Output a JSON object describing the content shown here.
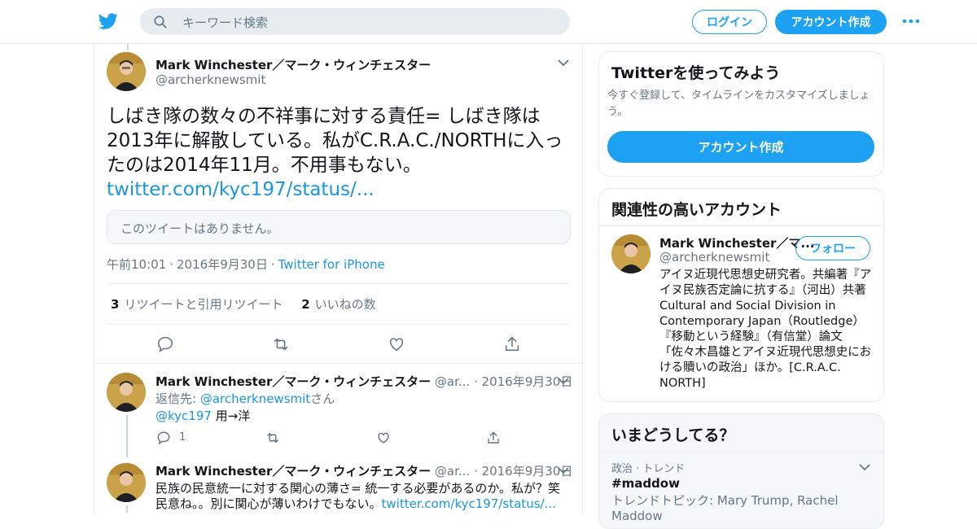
{
  "header": {
    "search_placeholder": "キーワード検索",
    "login_label": "ログイン",
    "signup_label": "アカウント作成",
    "brand_color": "#1da1f2"
  },
  "tweet": {
    "author_name": "Mark Winchester／マーク・ウィンチェスター",
    "author_handle": "@archerknewsmit",
    "text_main": "しばき隊の数々の不祥事に対する責任= しばき隊は2013年に解散している。私がC.R.A.C./NORTHに入ったのは2014年11月。不用事もない。",
    "text_link": "twitter.com/kyc197/status/...",
    "quote_unavailable": "このツイートはありません。",
    "time": "午前10:01",
    "date": "2016年9月30日",
    "source": "Twitter for iPhone",
    "retweet_count": "3",
    "retweet_label": "リツイートと引用リツイート",
    "like_count": "2",
    "like_label": "いいねの数"
  },
  "replies": [
    {
      "author_name": "Mark Winchester／マーク・ウィンチェスター",
      "handle_short": "@ar...",
      "date": "2016年9月30日",
      "reply_to_prefix": "返信先: ",
      "reply_to_handle": "@archerknewsmit",
      "reply_to_suffix": "さん",
      "mention": "@kyc197",
      "text": " 用→洋",
      "reply_count": "1"
    },
    {
      "author_name": "Mark Winchester／マーク・ウィンチェスター",
      "handle_short": "@ar...",
      "date": "2016年9月30日",
      "text_line1": "民族の民意統一に対する関心の薄さ= 統一する必要があるのか。私が？笑",
      "text_line2": "民意ね。。別に関心が薄いわけでもない。",
      "link": "twitter.com/kyc197/status/..."
    }
  ],
  "sidebar": {
    "try_card": {
      "title": "Twitterを使ってみよう",
      "subtitle": "今すぐ登録して、タイムラインをカスタマイズしましょう。",
      "button_label": "アカウント作成"
    },
    "related_card": {
      "title": "関連性の高いアカウント",
      "account_name": "Mark Winchester／マ...",
      "account_handle": "@archerknewsmit",
      "follow_label": "フォロー",
      "bio": "アイヌ近現代思想史研究者。共編著『アイヌ民族否定論に抗する』（河出）共著 Cultural and Social Division in Contemporary Japan（Routledge）『移動という経験』（有信堂）論文「佐々木昌雄とアイヌ近現代思想史における贖いの政治」ほか。[C.R.A.C. NORTH]"
    },
    "trends_card": {
      "title": "いまどうしてる？",
      "trend_category": "政治 · トレンド",
      "trend_name": "#maddow",
      "trend_topics": "トレンドトピック: Mary Trump, Rachel Maddow"
    }
  }
}
